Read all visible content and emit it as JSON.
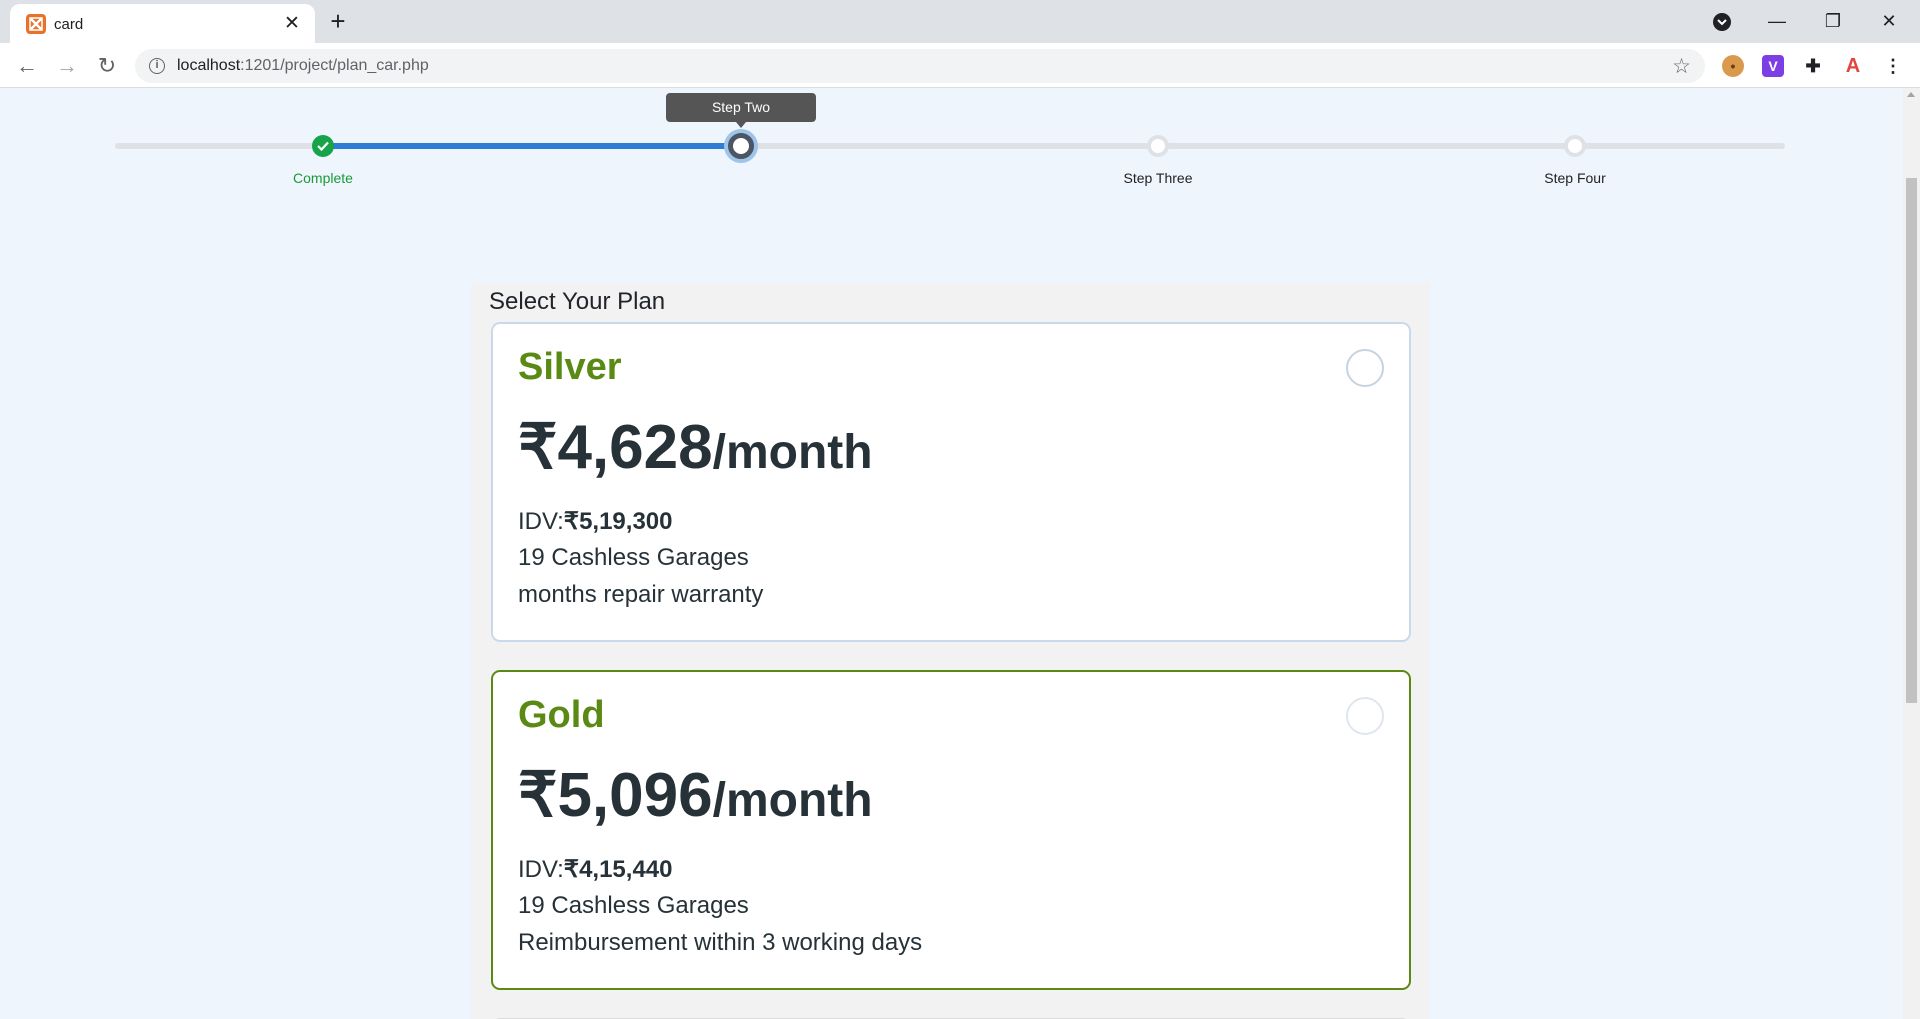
{
  "browser": {
    "tab_title": "card",
    "url_host": "localhost",
    "url_rest": ":1201/project/plan_car.php",
    "new_tab": "+",
    "close": "✕"
  },
  "stepper": {
    "tooltip": "Step Two",
    "steps": [
      {
        "label": "Complete",
        "state": "complete"
      },
      {
        "label": "",
        "state": "current"
      },
      {
        "label": "Step Three",
        "state": "pending"
      },
      {
        "label": "Step Four",
        "state": "pending"
      }
    ]
  },
  "plans": {
    "title": "Select Your Plan",
    "items": [
      {
        "name": "Silver",
        "price": "₹4,628",
        "period": "/month",
        "idv_label": "IDV:",
        "idv_value": "₹5,19,300",
        "garages": "19 Cashless Garages",
        "feature": "months repair warranty"
      },
      {
        "name": "Gold",
        "price": "₹5,096",
        "period": "/month",
        "idv_label": "IDV:",
        "idv_value": "₹4,15,440",
        "garages": "19 Cashless Garages",
        "feature": "Reimbursement within 3 working days"
      }
    ]
  },
  "colors": {
    "accent": "#5a8a14",
    "progress": "#2d7dd2",
    "complete": "#16a34a",
    "page_bg": "#eef5fd"
  }
}
